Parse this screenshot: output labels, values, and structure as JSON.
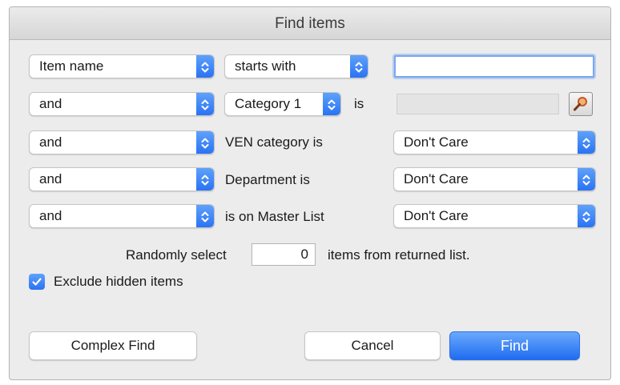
{
  "dialog": {
    "title": "Find items"
  },
  "row1": {
    "field_select": "Item name",
    "operator_select": "starts with",
    "value": ""
  },
  "row2": {
    "logic_select": "and",
    "category_select": "Category 1",
    "is_label": "is",
    "value": ""
  },
  "row3": {
    "logic_select": "and",
    "label": "VEN category is",
    "value_select": "Don't Care"
  },
  "row4": {
    "logic_select": "and",
    "label": "Department is",
    "value_select": "Don't Care"
  },
  "row5": {
    "logic_select": "and",
    "label": "is on Master List",
    "value_select": "Don't Care"
  },
  "random": {
    "prefix": "Randomly select",
    "count": "0",
    "suffix": "items from returned list."
  },
  "exclude_hidden": {
    "label": "Exclude hidden items",
    "checked": true
  },
  "buttons": {
    "complex_find": "Complex Find",
    "cancel": "Cancel",
    "find": "Find"
  },
  "colors": {
    "accent": "#2a73f3",
    "dialog_background": "#ececec"
  },
  "icons": {
    "popup_arrow": "chevron-up-down-icon",
    "lookup": "magnifier-icon",
    "checkbox": "checkmark-icon"
  }
}
